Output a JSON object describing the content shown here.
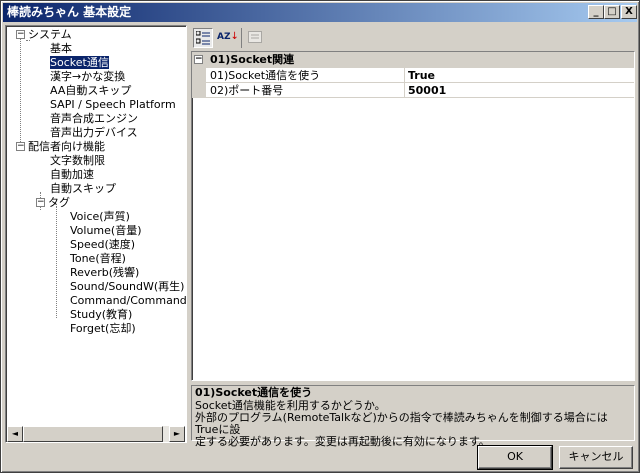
{
  "window": {
    "title": "棒読みちゃん 基本設定",
    "minimize": "_",
    "maximize": "□",
    "close": "X"
  },
  "tree": {
    "items": [
      {
        "label": "システム",
        "expander": "−"
      },
      {
        "label": "基本"
      },
      {
        "label": "Socket通信",
        "selected": true
      },
      {
        "label": "漢字→かな変換"
      },
      {
        "label": "AA自動スキップ"
      },
      {
        "label": "SAPI / Speech Platform"
      },
      {
        "label": "音声合成エンジン"
      },
      {
        "label": "音声出力デバイス"
      },
      {
        "label": "配信者向け機能",
        "expander": "−"
      },
      {
        "label": "文字数制限"
      },
      {
        "label": "自動加速"
      },
      {
        "label": "自動スキップ"
      },
      {
        "label": "タグ",
        "expander": "−"
      },
      {
        "label": "Voice(声質)"
      },
      {
        "label": "Volume(音量)"
      },
      {
        "label": "Speed(速度)"
      },
      {
        "label": "Tone(音程)"
      },
      {
        "label": "Reverb(残響)"
      },
      {
        "label": "Sound/SoundW(再生)"
      },
      {
        "label": "Command/CommandW"
      },
      {
        "label": "Study(教育)"
      },
      {
        "label": "Forget(忘却)"
      }
    ],
    "scroll_left": "◄",
    "scroll_right": "►"
  },
  "toolbar": {
    "categorized_icon": "categorized-icon",
    "alphabetical_icon": "alphabetical-icon",
    "alphabetical_text": "AZ",
    "pages_icon": "property-pages-icon"
  },
  "grid": {
    "category": "01)Socket関連",
    "category_expander": "−",
    "rows": [
      {
        "name": "01)Socket通信を使う",
        "value": "True"
      },
      {
        "name": "02)ポート番号",
        "value": "50001"
      }
    ]
  },
  "description": {
    "title": "01)Socket通信を使う",
    "line1": "Socket通信機能を利用するかどうか。",
    "line2": "外部のプログラム(RemoteTalkなど)からの指令で棒読みちゃんを制御する場合にはTrueに設",
    "line3": "定する必要があります。変更は再起動後に有効になります。"
  },
  "buttons": {
    "ok": "OK",
    "cancel": "キャンセル"
  }
}
